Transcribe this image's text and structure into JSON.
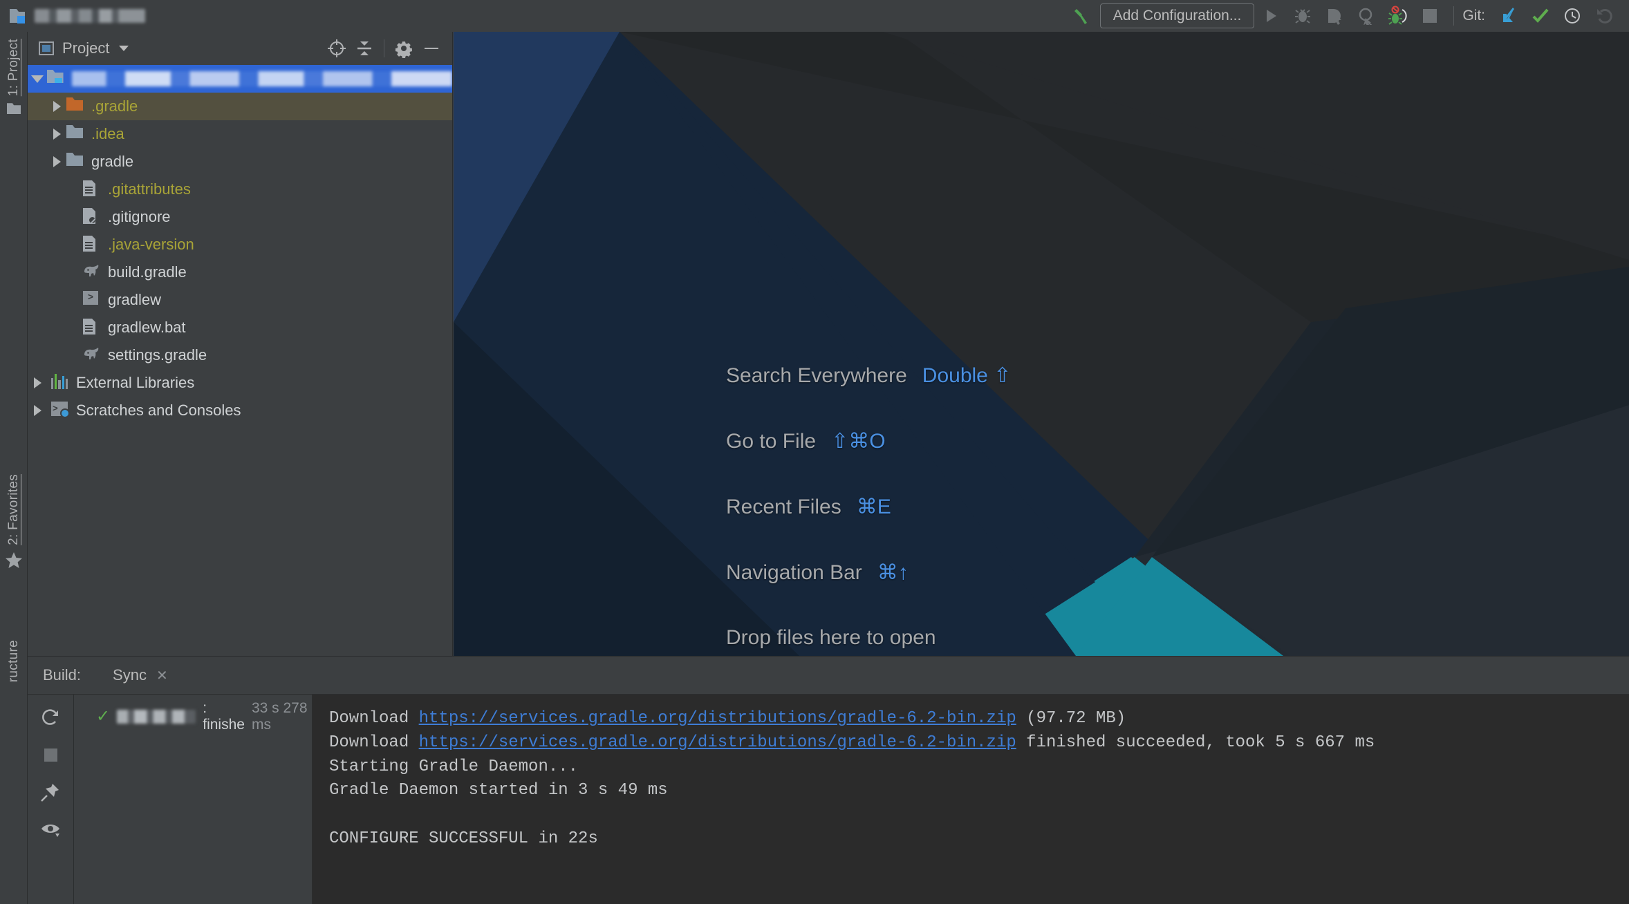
{
  "window": {
    "title_redacted": true,
    "project_icon": "project-folder-icon"
  },
  "toolbar": {
    "build_icon": "hammer-icon",
    "add_configuration_label": "Add Configuration...",
    "run_icon": "run-play-icon",
    "debug_icon": "debug-bug-icon",
    "run_coverage_icon": "run-with-coverage-icon",
    "profile_icon": "profiler-icon",
    "attach_icon": "attach-debugger-icon",
    "stop_icon": "stop-square-icon",
    "git_label": "Git:",
    "git_update_icon": "update-project-icon",
    "git_commit_icon": "commit-checkmark-icon",
    "git_history_icon": "history-clock-icon",
    "git_rollback_icon": "rollback-undo-icon"
  },
  "stripe_left": {
    "project_label": "1: Project",
    "favorites_label": "2: Favorites",
    "structure_label": "ructure",
    "project_icon": "folder-icon",
    "favorites_icon": "star-icon"
  },
  "project_panel": {
    "title": "Project",
    "view_icon": "project-view-icon",
    "dropdown_icon": "chevron-down-icon",
    "tools": [
      {
        "name": "locate-target-icon"
      },
      {
        "name": "collapse-all-icon"
      },
      {
        "name": "gear-icon"
      },
      {
        "name": "minimize-icon"
      }
    ],
    "tree": [
      {
        "label": "",
        "redacted": true,
        "icon": "folder-module-icon",
        "indent": 0,
        "arrow": "down",
        "selected": true,
        "color": "white"
      },
      {
        "label": ".gradle",
        "icon": "folder-orange-icon",
        "indent": 1,
        "arrow": "right",
        "highlight": true,
        "color": "yellow"
      },
      {
        "label": ".idea",
        "icon": "folder-icon",
        "indent": 1,
        "arrow": "right",
        "color": "yellow"
      },
      {
        "label": "gradle",
        "icon": "folder-icon",
        "indent": 1,
        "arrow": "right",
        "color": "white"
      },
      {
        "label": ".gitattributes",
        "icon": "file-doc-icon",
        "indent": 2,
        "arrow": "none",
        "color": "yellow"
      },
      {
        "label": ".gitignore",
        "icon": "file-ignored-icon",
        "indent": 2,
        "arrow": "none",
        "color": "white"
      },
      {
        "label": ".java-version",
        "icon": "file-doc-icon",
        "indent": 2,
        "arrow": "none",
        "color": "yellow"
      },
      {
        "label": "build.gradle",
        "icon": "gradle-elephant-icon",
        "indent": 2,
        "arrow": "none",
        "color": "white"
      },
      {
        "label": "gradlew",
        "icon": "shell-script-icon",
        "indent": 2,
        "arrow": "none",
        "color": "white"
      },
      {
        "label": "gradlew.bat",
        "icon": "file-doc-icon",
        "indent": 2,
        "arrow": "none",
        "color": "white"
      },
      {
        "label": "settings.gradle",
        "icon": "gradle-elephant-icon",
        "indent": 2,
        "arrow": "none",
        "color": "white"
      },
      {
        "label": "External Libraries",
        "icon": "libraries-icon",
        "indent": 0,
        "arrow": "right",
        "color": "white"
      },
      {
        "label": "Scratches and Consoles",
        "icon": "scratches-icon",
        "indent": 0,
        "arrow": "right",
        "color": "white"
      }
    ]
  },
  "editor": {
    "shortcuts": [
      {
        "name": "Search Everywhere",
        "keys": "Double ⇧"
      },
      {
        "name": "Go to File",
        "keys": "⇧⌘O"
      },
      {
        "name": "Recent Files",
        "keys": "⌘E"
      },
      {
        "name": "Navigation Bar",
        "keys": "⌘↑"
      },
      {
        "name": "Drop files here to open",
        "keys": ""
      }
    ],
    "colors": {
      "background": "#2B2B2B",
      "navy": "#1B2A3E",
      "navy_dark": "#16202E",
      "blue_light": "#20365A",
      "teal": "#17889C",
      "panel_dark": "#232A32"
    }
  },
  "build": {
    "label": "Build:",
    "tab": "Sync",
    "tab_close_icon": "close-icon",
    "actions": [
      {
        "name": "rerun-icon"
      },
      {
        "name": "stop-icon"
      },
      {
        "name": "pin-icon"
      },
      {
        "name": "toggle-view-icon"
      }
    ],
    "tree_node": {
      "status_icon": "success-check-icon",
      "name_redacted": true,
      "text": ": finishe",
      "duration": "33 s 278 ms"
    },
    "console": [
      {
        "parts": [
          {
            "t": "Download ",
            "type": "text"
          },
          {
            "t": "https://services.gradle.org/distributions/gradle-6.2-bin.zip",
            "type": "link"
          },
          {
            "t": " (97.72 MB)",
            "type": "text"
          }
        ]
      },
      {
        "parts": [
          {
            "t": "Download ",
            "type": "text"
          },
          {
            "t": "https://services.gradle.org/distributions/gradle-6.2-bin.zip",
            "type": "link"
          },
          {
            "t": " finished succeeded, took 5 s 667 ms",
            "type": "text"
          }
        ]
      },
      {
        "parts": [
          {
            "t": "Starting Gradle Daemon...",
            "type": "text"
          }
        ]
      },
      {
        "parts": [
          {
            "t": "Gradle Daemon started in 3 s 49 ms",
            "type": "text"
          }
        ]
      },
      {
        "parts": [
          {
            "t": "",
            "type": "text"
          }
        ]
      },
      {
        "parts": [
          {
            "t": "CONFIGURE SUCCESSFUL in 22s",
            "type": "text"
          }
        ]
      }
    ]
  }
}
